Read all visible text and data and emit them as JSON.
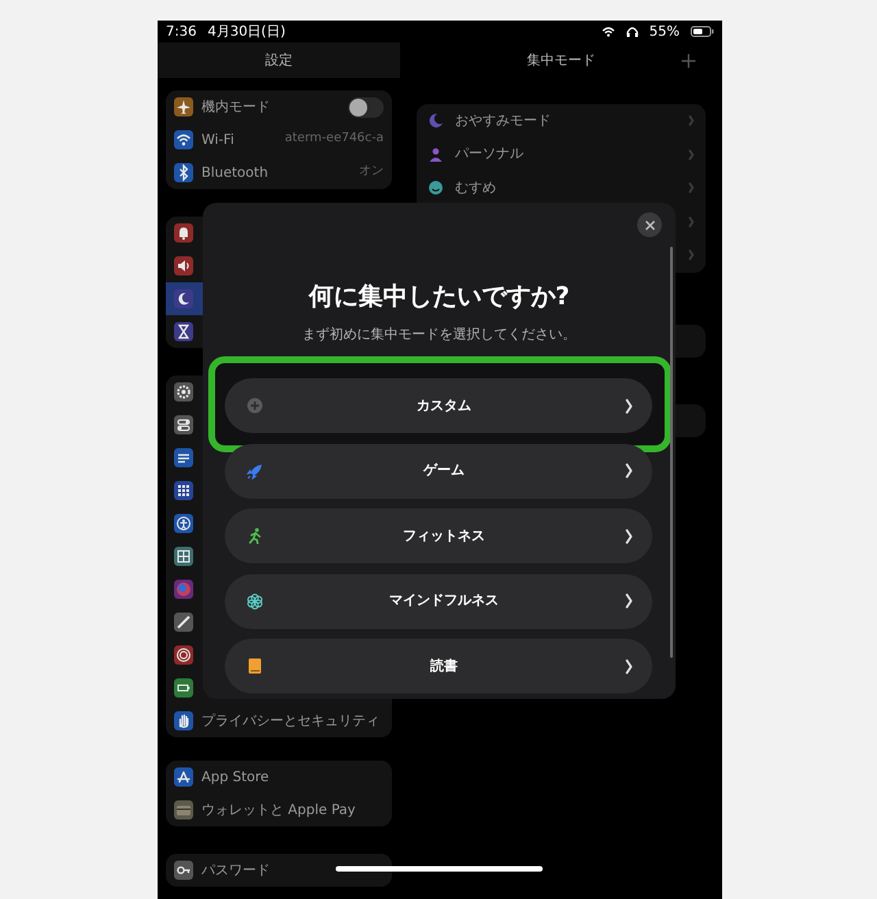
{
  "status_bar": {
    "time": "7:36",
    "date": "4月30日(日)",
    "battery": "55%"
  },
  "sidebar": {
    "title": "設定",
    "groups": [
      {
        "items": [
          {
            "kind": "toggle",
            "label": "機内モード",
            "on": false,
            "selected": false
          },
          {
            "kind": "value",
            "label": "Wi-Fi",
            "value": "aterm-ee746c-a",
            "selected": false
          },
          {
            "kind": "value",
            "label": "Bluetooth",
            "value": "オン",
            "selected": false
          }
        ]
      },
      {
        "items": [
          {
            "kind": "covered",
            "selected": false
          },
          {
            "kind": "covered",
            "selected": false
          },
          {
            "kind": "covered",
            "selected": true
          },
          {
            "kind": "covered",
            "selected": false
          }
        ]
      },
      {
        "items": [
          {
            "kind": "covered",
            "selected": false
          },
          {
            "kind": "covered",
            "selected": false
          },
          {
            "kind": "covered",
            "selected": false
          },
          {
            "kind": "covered",
            "selected": false
          },
          {
            "kind": "covered",
            "selected": false
          },
          {
            "kind": "covered",
            "selected": false
          },
          {
            "kind": "covered",
            "selected": false
          },
          {
            "kind": "covered",
            "selected": false
          },
          {
            "kind": "covered",
            "selected": false
          },
          {
            "kind": "covered",
            "selected": false
          },
          {
            "kind": "plain",
            "label": "プライバシーとセキュリティ",
            "selected": false
          }
        ]
      },
      {
        "items": [
          {
            "kind": "plain",
            "label": "App Store",
            "selected": false
          },
          {
            "kind": "plain",
            "label": "ウォレットと Apple Pay",
            "selected": false
          }
        ]
      },
      {
        "items": [
          {
            "kind": "plain",
            "label": "パスワード",
            "selected": false
          }
        ]
      }
    ]
  },
  "focus_pane": {
    "title": "集中モード",
    "modes": [
      {
        "kind": "labeled",
        "label": "おやすみモード"
      },
      {
        "kind": "labeled",
        "label": "パーソナル"
      },
      {
        "kind": "labeled",
        "label": "むすめ"
      },
      {
        "kind": "covered"
      },
      {
        "kind": "covered"
      }
    ]
  },
  "dialog": {
    "title": "何に集中したいですか?",
    "subtitle": "まず初めに集中モードを選択してください。",
    "options": [
      {
        "label": "カスタム",
        "highlighted": true
      },
      {
        "label": "ゲーム",
        "highlighted": false
      },
      {
        "label": "フィットネス",
        "highlighted": false
      },
      {
        "label": "マインドフルネス",
        "highlighted": false
      },
      {
        "label": "読書",
        "highlighted": false
      }
    ]
  }
}
